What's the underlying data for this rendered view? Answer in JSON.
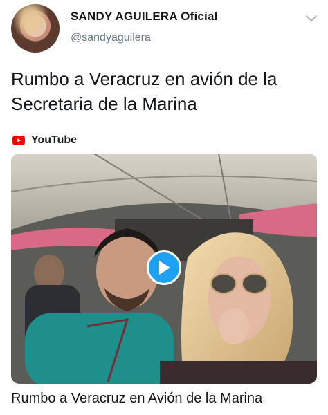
{
  "author": {
    "display_name": "SANDY AGUILERA Oficial",
    "handle": "@sandyaguilera"
  },
  "tweet": {
    "text": "Rumbo a Veracruz en avión de la\nSecretaria de la  Marina"
  },
  "source": {
    "label": "YouTube",
    "icon": "youtube-icon",
    "icon_color": "#ff0000"
  },
  "media": {
    "type": "video",
    "play_color": "#1da1f2",
    "title": "Rumbo a Veracruz en Avión de la Marina"
  },
  "colors": {
    "text": "#14171a",
    "secondary": "#657786"
  }
}
